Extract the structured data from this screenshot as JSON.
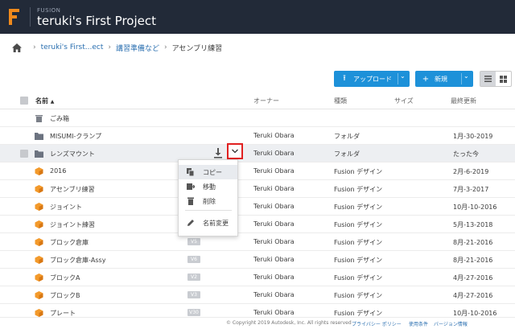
{
  "header": {
    "app_name": "FUSION",
    "project_title": "teruki's First Project"
  },
  "breadcrumb": {
    "home_icon": "home-icon",
    "items": [
      "teruki's First...ect",
      "講習準備など",
      "アセンブリ練習"
    ]
  },
  "toolbar": {
    "upload_label": "アップロード",
    "new_label": "新規",
    "accent_color": "#1d91d9"
  },
  "table": {
    "columns": [
      "名前",
      "オーナー",
      "種類",
      "サイズ",
      "最終更新"
    ],
    "sort_indicator": "▲",
    "trash_label": "ごみ箱",
    "rows": [
      {
        "name": "MISUMI-クランプ",
        "owner": "Teruki Obara",
        "type": "フォルダ",
        "updated": "1月-30-2019",
        "icon": "folder-icon"
      },
      {
        "name": "レンズマウント",
        "owner": "Teruki Obara",
        "type": "フォルダ",
        "updated": "たった今",
        "icon": "folder-icon"
      },
      {
        "name": "2016",
        "owner": "Teruki Obara",
        "type": "Fusion デザイン",
        "updated": "2月-6-2019",
        "icon": "design-cube-icon"
      },
      {
        "name": "アセンブリ練習",
        "owner": "Teruki Obara",
        "type": "Fusion デザイン",
        "updated": "7月-3-2017",
        "icon": "design-cube-icon"
      },
      {
        "name": "ジョイント",
        "owner": "Teruki Obara",
        "type": "Fusion デザイン",
        "updated": "10月-10-2016",
        "icon": "design-cube-icon"
      },
      {
        "name": "ジョイント練習",
        "owner": "Teruki Obara",
        "type": "Fusion デザイン",
        "updated": "5月-13-2018",
        "icon": "design-cube-icon"
      },
      {
        "name": "ブロック倉庫",
        "version": "V5",
        "owner": "Teruki Obara",
        "type": "Fusion デザイン",
        "updated": "8月-21-2016",
        "icon": "design-cube-icon"
      },
      {
        "name": "ブロック倉庫-Assy",
        "version": "V6",
        "owner": "Teruki Obara",
        "type": "Fusion デザイン",
        "updated": "8月-21-2016",
        "icon": "design-cube-icon"
      },
      {
        "name": "ブロックA",
        "version": "V2",
        "owner": "Teruki Obara",
        "type": "Fusion デザイン",
        "updated": "4月-27-2016",
        "icon": "design-cube-icon"
      },
      {
        "name": "ブロックB",
        "version": "V3",
        "owner": "Teruki Obara",
        "type": "Fusion デザイン",
        "updated": "4月-27-2016",
        "icon": "design-cube-icon"
      },
      {
        "name": "プレート",
        "version": "V30",
        "owner": "Teruki Obara",
        "type": "Fusion デザイン",
        "updated": "10月-10-2016",
        "icon": "design-cube-icon"
      }
    ]
  },
  "context_menu": {
    "items": [
      {
        "label": "コピー",
        "icon": "copy-icon"
      },
      {
        "label": "移動",
        "icon": "move-icon"
      },
      {
        "label": "削除",
        "icon": "trash-icon"
      },
      {
        "label": "名前変更",
        "icon": "pencil-icon"
      }
    ]
  },
  "footer": {
    "copyright": "© Copyright 2019 Autodesk, Inc. All rights reserved",
    "privacy": "プライバシー ポリシー",
    "terms": "使用条件",
    "version": "バージョン情報"
  }
}
